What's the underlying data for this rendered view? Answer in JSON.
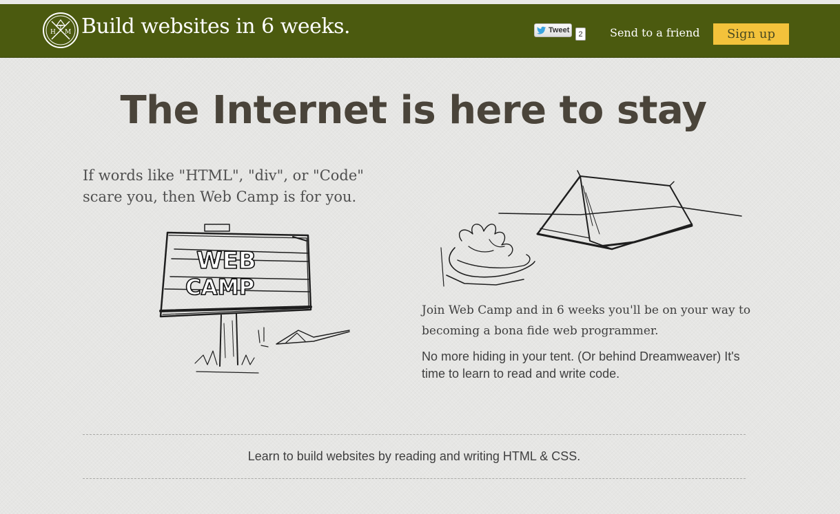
{
  "header": {
    "brand_title": "Build websites in 6 weeks.",
    "logo_letters": "HTM",
    "tweet_label": "Tweet",
    "tweet_count": "2",
    "send_link": "Send to a friend",
    "signup_label": "Sign up"
  },
  "main": {
    "headline": "The Internet is here to stay",
    "intro": "If words like \"HTML\", \"div\", or \"Code\" scare you, then Web Camp is for you.",
    "sign_text_line1": "WEB",
    "sign_text_line2": "CAMP",
    "join_text": "Join Web Camp and in 6 weeks you'll be on your way to becoming a bona fide web programmer.",
    "nomore_text": "No more hiding in your tent. (Or behind Dreamweaver) It's time to learn to read and write code.",
    "tagline": "Learn to build websites by reading and writing HTML & CSS."
  },
  "colors": {
    "header_bg": "#4b5a0f",
    "signup_bg": "#f3c23b",
    "page_bg": "#e6e6e4",
    "headline_text": "#4a443a"
  },
  "icons": {
    "logo": "htm-compass-badge-icon",
    "tweet": "twitter-bird-icon"
  }
}
